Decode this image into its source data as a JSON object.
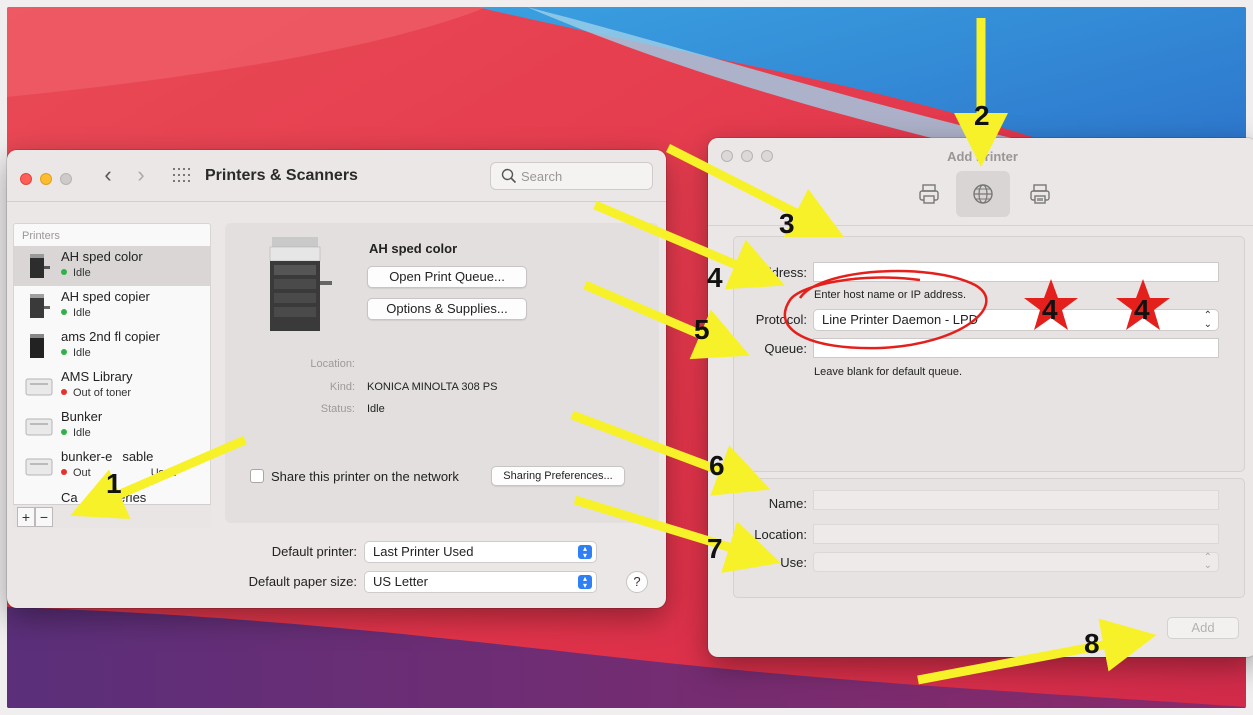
{
  "printers_window": {
    "title": "Printers & Scanners",
    "search_placeholder": "Search",
    "sidebar_header": "Printers",
    "printers": [
      {
        "name": "AH sped color",
        "status": "Idle",
        "status_color": "green",
        "selected": true
      },
      {
        "name": "AH sped copier",
        "status": "Idle",
        "status_color": "green",
        "selected": false
      },
      {
        "name": "ams 2nd fl copier",
        "status": "Idle",
        "status_color": "green",
        "selected": false
      },
      {
        "name": "AMS Library",
        "status": "Out of toner",
        "status_color": "red",
        "selected": false
      },
      {
        "name": "Bunker",
        "status": "Idle",
        "status_color": "green",
        "selected": false
      },
      {
        "name": "bunker-e",
        "name_tail": "sable",
        "status": "Out",
        "status_tail": "Used",
        "status_color": "red",
        "selected": false
      },
      {
        "name": "Ca",
        "name_tail": "series",
        "status": "",
        "status_color": "",
        "selected": false
      }
    ],
    "add_label": "+",
    "remove_label": "−",
    "detail": {
      "name": "AH sped color",
      "open_queue_label": "Open Print Queue...",
      "options_label": "Options & Supplies...",
      "location_label": "Location:",
      "location_value": "",
      "kind_label": "Kind:",
      "kind_value": "KONICA MINOLTA 308 PS",
      "status_label": "Status:",
      "status_value": "Idle",
      "share_label": "Share this printer on the network",
      "sharing_prefs_label": "Sharing Preferences..."
    },
    "default_printer_label": "Default printer:",
    "default_printer_value": "Last Printer Used",
    "default_paper_label": "Default paper size:",
    "default_paper_value": "US Letter",
    "help_label": "?"
  },
  "add_printer_window": {
    "title": "Add Printer",
    "toolbar": [
      {
        "icon": "printer-icon",
        "selected": false
      },
      {
        "icon": "globe-icon",
        "selected": true
      },
      {
        "icon": "printer-windows-icon",
        "selected": false
      }
    ],
    "address_label": "Address:",
    "address_value": "",
    "address_hint": "Enter host name or IP address.",
    "protocol_label": "Protocol:",
    "protocol_value": "Line Printer Daemon - LPD",
    "queue_label": "Queue:",
    "queue_value": "",
    "queue_hint": "Leave blank for default queue.",
    "name_label": "Name:",
    "name_value": "",
    "location_label": "Location:",
    "location_value": "",
    "use_label": "Use:",
    "use_value": "",
    "add_button": "Add"
  },
  "annotations": {
    "numbers": [
      "1",
      "2",
      "3",
      "4",
      "5",
      "6",
      "7",
      "8"
    ],
    "star_numbers": [
      "4",
      "4"
    ],
    "arrow_color": "#f7f12a",
    "star_color": "#e4201c",
    "circle_color": "#e4201c"
  },
  "colors": {
    "accent": "#2f7ff5",
    "window_bg": "#ebe7e6"
  }
}
